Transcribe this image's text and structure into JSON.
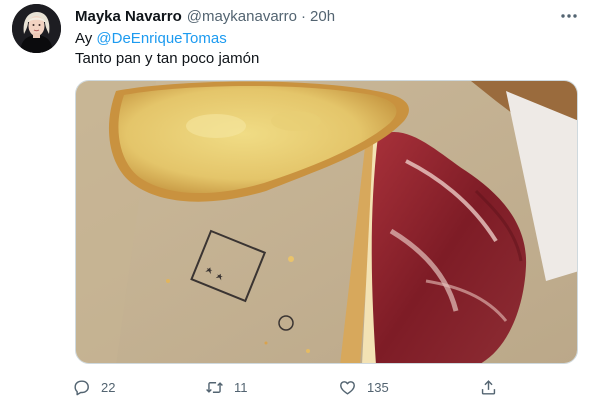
{
  "tweet": {
    "author_name": "Mayka Navarro",
    "author_handle": "@maykanavarro",
    "separator": "·",
    "timestamp": "20h",
    "text_prefix": "Ay ",
    "mention": "@DeEnriqueTomas",
    "text_line2": "Tanto pan y tan poco jamón",
    "actions": {
      "reply_count": "22",
      "retweet_count": "11",
      "like_count": "135"
    }
  },
  "icons": {
    "more": "more-horizontal-icon",
    "reply": "reply-bubble-icon",
    "retweet": "retweet-icon",
    "like": "heart-icon",
    "share": "share-icon"
  },
  "colors": {
    "text_primary": "#0f1419",
    "text_secondary": "#536471",
    "link": "#1d9bf0",
    "border": "#cfd9de"
  }
}
